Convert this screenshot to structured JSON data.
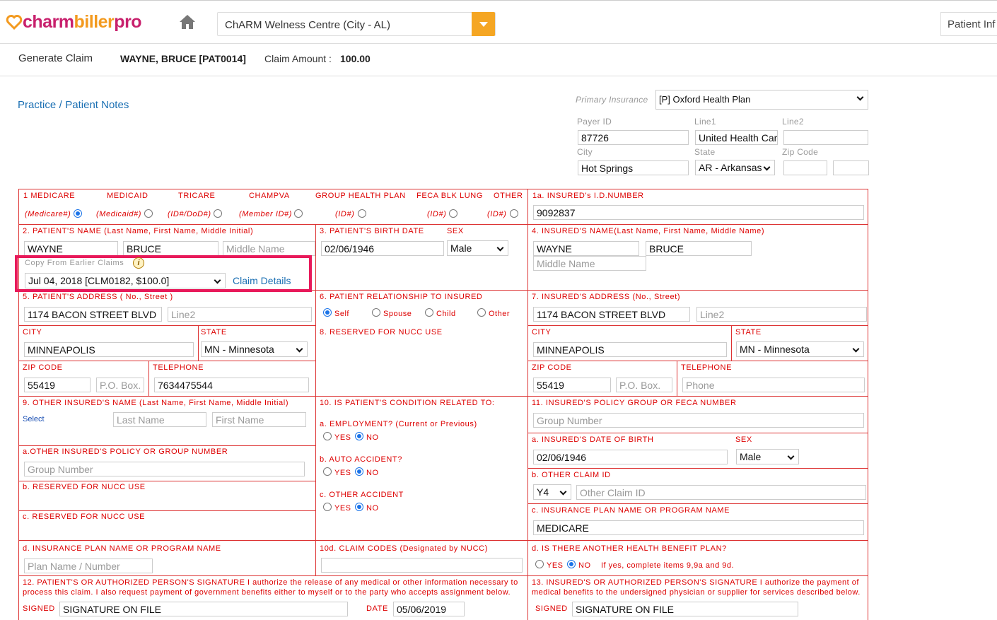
{
  "app": {
    "logo_part1": "charm",
    "logo_part2": "biller",
    "logo_part3": "pro",
    "facility": "ChARM Welness Centre (City - AL)",
    "patient_info_button": "Patient Inf"
  },
  "subbar": {
    "title": "Generate Claim",
    "patient": "WAYNE, BRUCE [PAT0014]",
    "claim_amount_label": "Claim Amount :",
    "claim_amount": "100.00"
  },
  "notes_link": {
    "practice": "Practice",
    "sep": "/",
    "patient": "Patient Notes"
  },
  "insurance": {
    "primary_label": "Primary Insurance",
    "primary_value": "[P] Oxford Health Plan",
    "payer_id_label": "Payer ID",
    "payer_id": "87726",
    "line1_label": "Line1",
    "line1": "United Health Car",
    "line2_label": "Line2",
    "line2": "",
    "city_label": "City",
    "city": "Hot Springs",
    "state_label": "State",
    "state": "AR - Arkansas",
    "zip_label": "Zip Code",
    "zip": "",
    "zip2": ""
  },
  "box1": {
    "labels": [
      "1  MEDICARE",
      "MEDICAID",
      "TRICARE",
      "CHAMPVA",
      "GROUP HEALTH PLAN",
      "FECA BLK LUNG",
      "OTHER"
    ],
    "sublabels": [
      "(Medicare#)",
      "(Medicaid#)",
      "(ID#/DoD#)",
      "(Member ID#)",
      "(ID#)",
      "(ID#)",
      "(ID#)"
    ]
  },
  "box1a": {
    "label": "1a. INSURED's I.D.NUMBER",
    "value": "9092837"
  },
  "box2": {
    "label": "2. PATIENT'S NAME (Last Name, First Name, Middle Initial)",
    "last": "WAYNE",
    "first": "BRUCE",
    "middle_ph": "Middle Name"
  },
  "copy": {
    "label": "Copy From Earlier Claims",
    "value": "Jul 04, 2018 [CLM0182, $100.0]",
    "details": "Claim Details"
  },
  "box3": {
    "label": "3. PATIENT'S BIRTH DATE",
    "sex_label": "SEX",
    "dob": "02/06/1946",
    "sex": "Male"
  },
  "box4": {
    "label": "4. INSURED'S NAME(Last Name, First Name, Middle Name)",
    "last": "WAYNE",
    "first": "BRUCE",
    "middle_ph": "Middle Name"
  },
  "box5": {
    "label": "5. PATIENT'S ADDRESS ( No., Street )",
    "street": "1174 BACON STREET BLVD",
    "line2_ph": "Line2",
    "city_label": "CITY",
    "city": "MINNEAPOLIS",
    "state_label": "STATE",
    "state": "MN - Minnesota",
    "zip_label": "ZIP CODE",
    "zip": "55419",
    "pobox_ph": "P.O. Box.",
    "tel_label": "TELEPHONE",
    "tel": "7634475544"
  },
  "box6": {
    "label": "6. PATIENT RELATIONSHIP TO INSURED",
    "opts": [
      "Self",
      "Spouse",
      "Child",
      "Other"
    ]
  },
  "box7": {
    "label": "7. INSURED'S ADDRESS (No., Street)",
    "street": "1174 BACON STREET BLVD",
    "line2_ph": "Line2",
    "city_label": "CITY",
    "city": "MINNEAPOLIS",
    "state_label": "STATE",
    "state": "MN - Minnesota",
    "zip_label": "ZIP CODE",
    "zip": "55419",
    "pobox_ph": "P.O. Box.",
    "tel_label": "TELEPHONE",
    "tel_ph": "Phone"
  },
  "box8": {
    "label": "8. RESERVED FOR NUCC USE"
  },
  "box9": {
    "label": "9. OTHER INSURED'S NAME (Last Name, First Name, Middle Initial)",
    "select": "Select",
    "last_ph": "Last Name",
    "first_ph": "First Name",
    "a_label": "a.OTHER INSURED'S POLICY OR GROUP NUMBER",
    "group_ph": "Group Number",
    "b_label": "b. RESERVED FOR NUCC USE",
    "c_label": "c. RESERVED FOR NUCC USE",
    "d_label": "d. INSURANCE PLAN NAME OR PROGRAM NAME",
    "plan_ph": "Plan Name / Number"
  },
  "box10": {
    "label": "10. IS PATIENT'S CONDITION RELATED TO:",
    "a": "a. EMPLOYMENT? (Current or Previous)",
    "b": "b. AUTO ACCIDENT?",
    "c": "c. OTHER ACCIDENT",
    "yes": "YES",
    "no": "NO",
    "d_label": "10d. CLAIM CODES (Designated by NUCC)"
  },
  "box11": {
    "label": "11. INSURED'S POLICY GROUP OR FECA NUMBER",
    "group_ph": "Group Number",
    "a_label": "a. INSURED'S DATE OF BIRTH",
    "sex_label": "SEX",
    "dob": "02/06/1946",
    "sex": "Male",
    "b_label": "b. OTHER CLAIM ID",
    "claim_qual": "Y4",
    "claim_id_ph": "Other Claim ID",
    "c_label": "c. INSURANCE PLAN NAME OR PROGRAM NAME",
    "plan": "MEDICARE",
    "d_label": "d. IS THERE ANOTHER HEALTH BENEFIT PLAN?",
    "yes": "YES",
    "no": "NO",
    "d_note": "If yes, complete items 9,9a and 9d."
  },
  "box12": {
    "text": "12. PATIENT'S OR AUTHORIZED PERSON'S SIGNATURE I authorize the release of any medical or other information necessary to process this claim. I also request payment of government benefits either to myself or to the party who accepts assignment below.",
    "signed_label": "SIGNED",
    "signed": "SIGNATURE ON FILE",
    "date_label": "DATE",
    "date": "05/06/2019"
  },
  "box13": {
    "text": "13. INSURED'S OR AUTHORIZED PERSON'S SIGNATURE I authorize the payment of medical benefits to the undersigned physician or supplier for services described below.",
    "signed_label": "SIGNED",
    "signed": "SIGNATURE ON FILE"
  },
  "colors": {
    "accent": "#f5a623",
    "brand": "#c8216d",
    "form_red": "#d33",
    "highlight": "#e8195a",
    "link": "#1a6fb3"
  }
}
